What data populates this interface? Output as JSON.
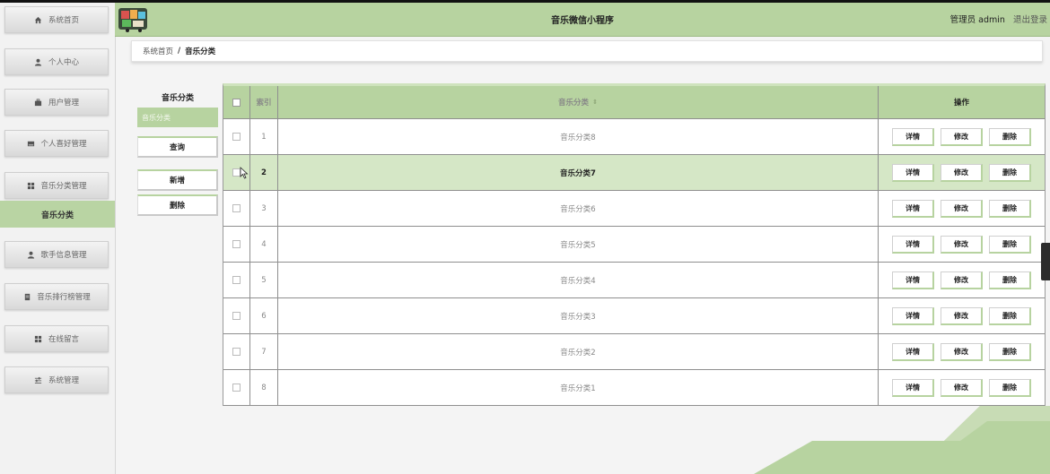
{
  "header": {
    "title": "音乐微信小程序",
    "user_label": "管理员 admin",
    "logout": "退出登录"
  },
  "sidebar": {
    "items": [
      {
        "label": "系统首页",
        "icon": "home-icon"
      },
      {
        "label": "个人中心",
        "icon": "user-icon"
      },
      {
        "label": "用户管理",
        "icon": "briefcase-icon"
      },
      {
        "label": "个人喜好管理",
        "icon": "card-icon"
      },
      {
        "label": "音乐分类管理",
        "icon": "grid-icon"
      },
      {
        "label": "歌手信息管理",
        "icon": "user-icon"
      },
      {
        "label": "音乐排行榜管理",
        "icon": "list-icon"
      },
      {
        "label": "在线留言",
        "icon": "grid-icon"
      },
      {
        "label": "系统管理",
        "icon": "sliders-icon"
      }
    ],
    "active_sub": "音乐分类"
  },
  "breadcrumb": {
    "home": "系统首页",
    "separator": "/",
    "current": "音乐分类"
  },
  "side_panel": {
    "title": "音乐分类",
    "active_item": "音乐分类",
    "search_button": "查询",
    "add_button": "新增",
    "delete_button": "删除"
  },
  "table": {
    "columns": {
      "index": "索引",
      "name": "音乐分类",
      "ops": "操作"
    },
    "op_labels": {
      "detail": "详情",
      "edit": "修改",
      "delete": "删除"
    },
    "rows": [
      {
        "index": "1",
        "name": "音乐分类8"
      },
      {
        "index": "2",
        "name": "音乐分类7"
      },
      {
        "index": "3",
        "name": "音乐分类6"
      },
      {
        "index": "4",
        "name": "音乐分类5"
      },
      {
        "index": "5",
        "name": "音乐分类4"
      },
      {
        "index": "6",
        "name": "音乐分类3"
      },
      {
        "index": "7",
        "name": "音乐分类2"
      },
      {
        "index": "8",
        "name": "音乐分类1"
      }
    ],
    "highlighted_row": 2
  },
  "colors": {
    "accent": "#b7d3a0",
    "accent_dark": "#9dbb86",
    "highlight_row": "#d5e7c6"
  }
}
